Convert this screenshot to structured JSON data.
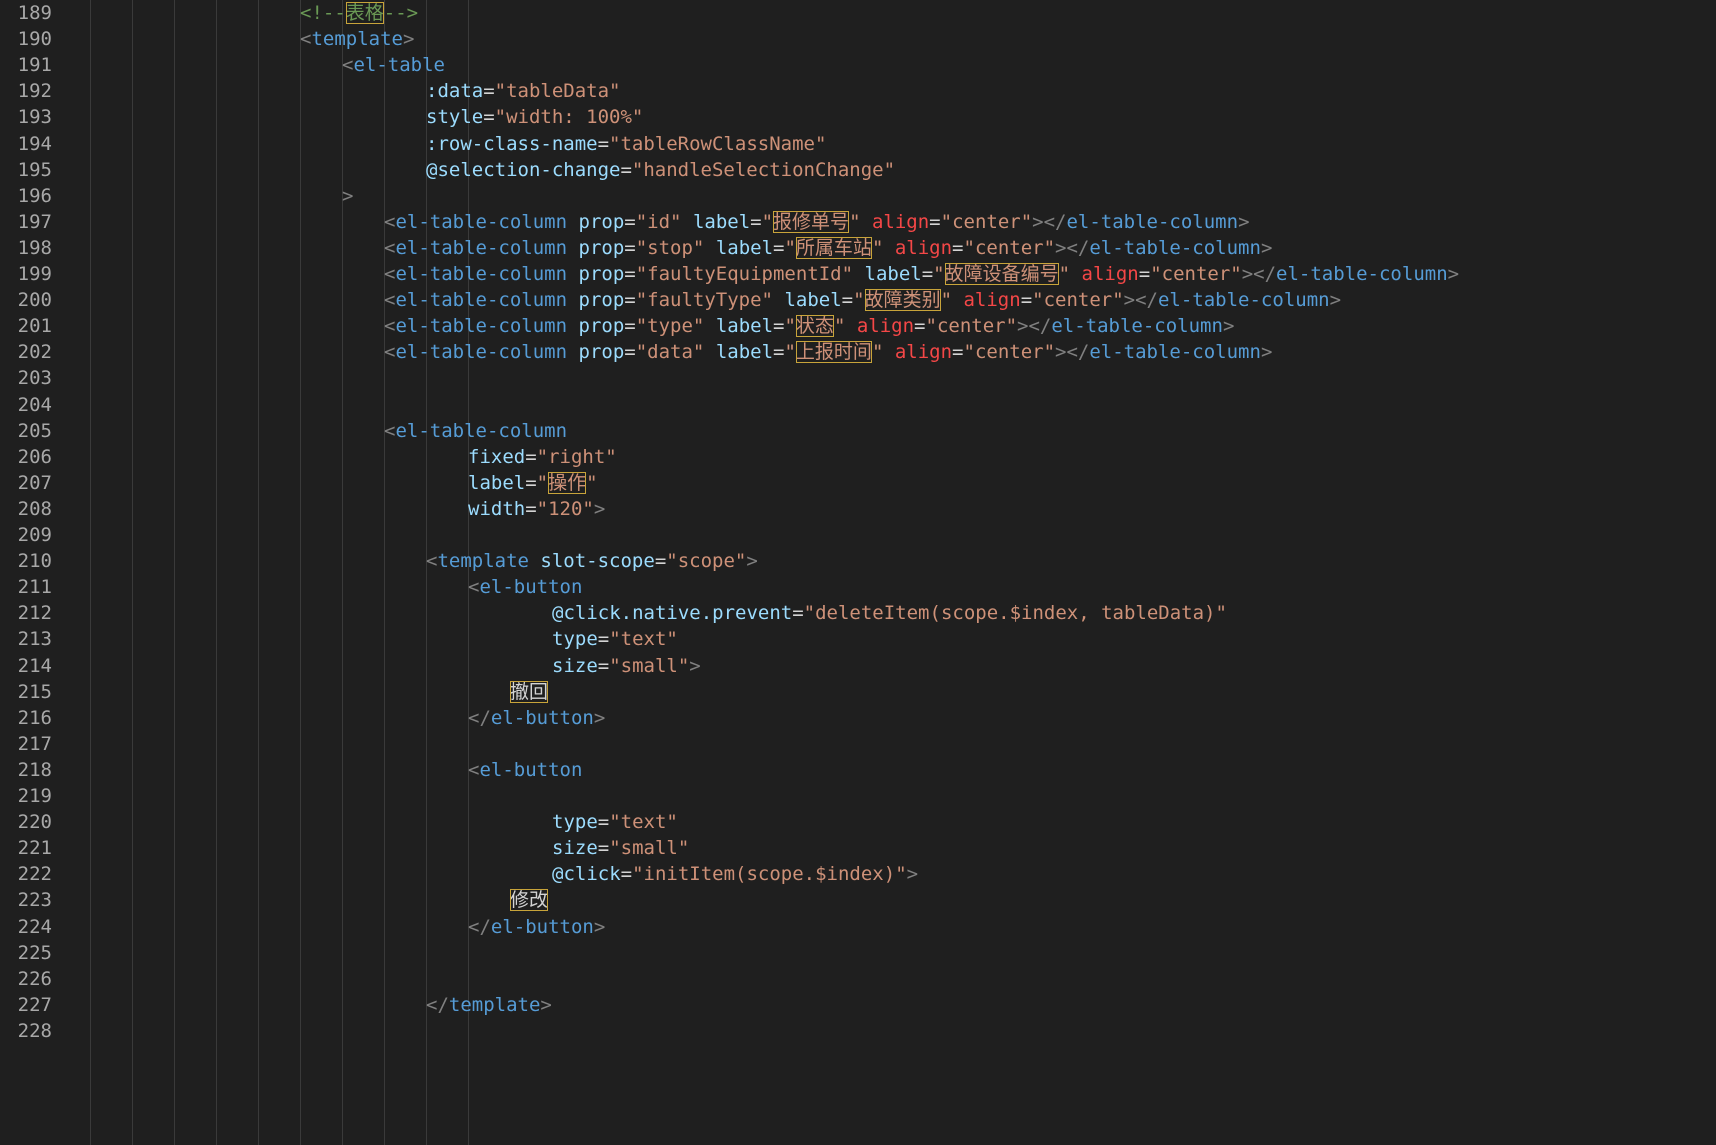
{
  "editor": {
    "language": "vue-template",
    "theme_colors": {
      "background": "#1f1f1f",
      "line_number": "#a8a8a8",
      "tag": "#569cd6",
      "attribute": "#9cdcfe",
      "attribute_alt": "#f44747",
      "string": "#ce9178",
      "comment": "#6a9955",
      "cjk_highlight_border": "#c8a43a"
    },
    "lines": [
      {
        "n": "189",
        "indent": 7,
        "tokens": [
          {
            "t": "<!--",
            "c": "cmt"
          },
          {
            "t": "表格",
            "c": "cmt",
            "box": true
          },
          {
            "t": "-->",
            "c": "cmt"
          }
        ]
      },
      {
        "n": "190",
        "indent": 7,
        "tokens": [
          {
            "t": "<",
            "c": "punc"
          },
          {
            "t": "template",
            "c": "tag"
          },
          {
            "t": ">",
            "c": "punc"
          }
        ]
      },
      {
        "n": "191",
        "indent": 8,
        "tokens": [
          {
            "t": "<",
            "c": "punc"
          },
          {
            "t": "el-table",
            "c": "tag"
          }
        ]
      },
      {
        "n": "192",
        "indent": 10,
        "tokens": [
          {
            "t": ":data",
            "c": "attr"
          },
          {
            "t": "=",
            "c": "txt"
          },
          {
            "t": "\"tableData\"",
            "c": "str"
          }
        ]
      },
      {
        "n": "193",
        "indent": 10,
        "tokens": [
          {
            "t": "style",
            "c": "attr"
          },
          {
            "t": "=",
            "c": "txt"
          },
          {
            "t": "\"width: 100%\"",
            "c": "str"
          }
        ]
      },
      {
        "n": "194",
        "indent": 10,
        "tokens": [
          {
            "t": ":row-class-name",
            "c": "attr"
          },
          {
            "t": "=",
            "c": "txt"
          },
          {
            "t": "\"tableRowClassName\"",
            "c": "str"
          }
        ]
      },
      {
        "n": "195",
        "indent": 10,
        "tokens": [
          {
            "t": "@selection-change",
            "c": "attr"
          },
          {
            "t": "=",
            "c": "txt"
          },
          {
            "t": "\"handleSelectionChange\"",
            "c": "str"
          }
        ]
      },
      {
        "n": "196",
        "indent": 8,
        "tokens": [
          {
            "t": ">",
            "c": "punc"
          }
        ]
      },
      {
        "n": "197",
        "indent": 9,
        "tokens": [
          {
            "t": "<",
            "c": "punc"
          },
          {
            "t": "el-table-column",
            "c": "tag"
          },
          {
            "t": " ",
            "c": "txt"
          },
          {
            "t": "prop",
            "c": "attr"
          },
          {
            "t": "=",
            "c": "txt"
          },
          {
            "t": "\"id\"",
            "c": "str"
          },
          {
            "t": " ",
            "c": "txt"
          },
          {
            "t": "label",
            "c": "attr"
          },
          {
            "t": "=",
            "c": "txt"
          },
          {
            "t": "\"",
            "c": "str"
          },
          {
            "t": "报修单号",
            "c": "str",
            "box": true
          },
          {
            "t": "\"",
            "c": "str"
          },
          {
            "t": " ",
            "c": "txt"
          },
          {
            "t": "align",
            "c": "attr-red"
          },
          {
            "t": "=",
            "c": "txt"
          },
          {
            "t": "\"center\"",
            "c": "str"
          },
          {
            "t": "></",
            "c": "punc"
          },
          {
            "t": "el-table-column",
            "c": "tag"
          },
          {
            "t": ">",
            "c": "punc"
          }
        ]
      },
      {
        "n": "198",
        "indent": 9,
        "tokens": [
          {
            "t": "<",
            "c": "punc"
          },
          {
            "t": "el-table-column",
            "c": "tag"
          },
          {
            "t": " ",
            "c": "txt"
          },
          {
            "t": "prop",
            "c": "attr"
          },
          {
            "t": "=",
            "c": "txt"
          },
          {
            "t": "\"stop\"",
            "c": "str"
          },
          {
            "t": " ",
            "c": "txt"
          },
          {
            "t": "label",
            "c": "attr"
          },
          {
            "t": "=",
            "c": "txt"
          },
          {
            "t": "\"",
            "c": "str"
          },
          {
            "t": "所属车站",
            "c": "str",
            "box": true
          },
          {
            "t": "\"",
            "c": "str"
          },
          {
            "t": " ",
            "c": "txt"
          },
          {
            "t": "align",
            "c": "attr-red"
          },
          {
            "t": "=",
            "c": "txt"
          },
          {
            "t": "\"center\"",
            "c": "str"
          },
          {
            "t": "></",
            "c": "punc"
          },
          {
            "t": "el-table-column",
            "c": "tag"
          },
          {
            "t": ">",
            "c": "punc"
          }
        ]
      },
      {
        "n": "199",
        "indent": 9,
        "tokens": [
          {
            "t": "<",
            "c": "punc"
          },
          {
            "t": "el-table-column",
            "c": "tag"
          },
          {
            "t": " ",
            "c": "txt"
          },
          {
            "t": "prop",
            "c": "attr"
          },
          {
            "t": "=",
            "c": "txt"
          },
          {
            "t": "\"faultyEquipmentId\"",
            "c": "str"
          },
          {
            "t": " ",
            "c": "txt"
          },
          {
            "t": "label",
            "c": "attr"
          },
          {
            "t": "=",
            "c": "txt"
          },
          {
            "t": "\"",
            "c": "str"
          },
          {
            "t": "故障设备编号",
            "c": "str",
            "box": true
          },
          {
            "t": "\"",
            "c": "str"
          },
          {
            "t": " ",
            "c": "txt"
          },
          {
            "t": "align",
            "c": "attr-red"
          },
          {
            "t": "=",
            "c": "txt"
          },
          {
            "t": "\"center\"",
            "c": "str"
          },
          {
            "t": "></",
            "c": "punc"
          },
          {
            "t": "el-table-column",
            "c": "tag"
          },
          {
            "t": ">",
            "c": "punc"
          }
        ]
      },
      {
        "n": "200",
        "indent": 9,
        "tokens": [
          {
            "t": "<",
            "c": "punc"
          },
          {
            "t": "el-table-column",
            "c": "tag"
          },
          {
            "t": " ",
            "c": "txt"
          },
          {
            "t": "prop",
            "c": "attr"
          },
          {
            "t": "=",
            "c": "txt"
          },
          {
            "t": "\"faultyType\"",
            "c": "str"
          },
          {
            "t": " ",
            "c": "txt"
          },
          {
            "t": "label",
            "c": "attr"
          },
          {
            "t": "=",
            "c": "txt"
          },
          {
            "t": "\"",
            "c": "str"
          },
          {
            "t": "故障类别",
            "c": "str",
            "box": true
          },
          {
            "t": "\"",
            "c": "str"
          },
          {
            "t": " ",
            "c": "txt"
          },
          {
            "t": "align",
            "c": "attr-red"
          },
          {
            "t": "=",
            "c": "txt"
          },
          {
            "t": "\"center\"",
            "c": "str"
          },
          {
            "t": "></",
            "c": "punc"
          },
          {
            "t": "el-table-column",
            "c": "tag"
          },
          {
            "t": ">",
            "c": "punc"
          }
        ]
      },
      {
        "n": "201",
        "indent": 9,
        "tokens": [
          {
            "t": "<",
            "c": "punc"
          },
          {
            "t": "el-table-column",
            "c": "tag"
          },
          {
            "t": " ",
            "c": "txt"
          },
          {
            "t": "prop",
            "c": "attr"
          },
          {
            "t": "=",
            "c": "txt"
          },
          {
            "t": "\"type\"",
            "c": "str"
          },
          {
            "t": " ",
            "c": "txt"
          },
          {
            "t": "label",
            "c": "attr"
          },
          {
            "t": "=",
            "c": "txt"
          },
          {
            "t": "\"",
            "c": "str"
          },
          {
            "t": "状态",
            "c": "str",
            "box": true
          },
          {
            "t": "\"",
            "c": "str"
          },
          {
            "t": " ",
            "c": "txt"
          },
          {
            "t": "align",
            "c": "attr-red"
          },
          {
            "t": "=",
            "c": "txt"
          },
          {
            "t": "\"center\"",
            "c": "str"
          },
          {
            "t": "></",
            "c": "punc"
          },
          {
            "t": "el-table-column",
            "c": "tag"
          },
          {
            "t": ">",
            "c": "punc"
          }
        ]
      },
      {
        "n": "202",
        "indent": 9,
        "tokens": [
          {
            "t": "<",
            "c": "punc"
          },
          {
            "t": "el-table-column",
            "c": "tag"
          },
          {
            "t": " ",
            "c": "txt"
          },
          {
            "t": "prop",
            "c": "attr"
          },
          {
            "t": "=",
            "c": "txt"
          },
          {
            "t": "\"data\"",
            "c": "str"
          },
          {
            "t": " ",
            "c": "txt"
          },
          {
            "t": "label",
            "c": "attr"
          },
          {
            "t": "=",
            "c": "txt"
          },
          {
            "t": "\"",
            "c": "str"
          },
          {
            "t": "上报时间",
            "c": "str",
            "box": true
          },
          {
            "t": "\"",
            "c": "str"
          },
          {
            "t": " ",
            "c": "txt"
          },
          {
            "t": "align",
            "c": "attr-red"
          },
          {
            "t": "=",
            "c": "txt"
          },
          {
            "t": "\"center\"",
            "c": "str"
          },
          {
            "t": "></",
            "c": "punc"
          },
          {
            "t": "el-table-column",
            "c": "tag"
          },
          {
            "t": ">",
            "c": "punc"
          }
        ]
      },
      {
        "n": "203",
        "indent": 0,
        "tokens": []
      },
      {
        "n": "204",
        "indent": 0,
        "tokens": []
      },
      {
        "n": "205",
        "indent": 9,
        "tokens": [
          {
            "t": "<",
            "c": "punc"
          },
          {
            "t": "el-table-column",
            "c": "tag"
          }
        ]
      },
      {
        "n": "206",
        "indent": 11,
        "tokens": [
          {
            "t": "fixed",
            "c": "attr"
          },
          {
            "t": "=",
            "c": "txt"
          },
          {
            "t": "\"right\"",
            "c": "str"
          }
        ]
      },
      {
        "n": "207",
        "indent": 11,
        "tokens": [
          {
            "t": "label",
            "c": "attr"
          },
          {
            "t": "=",
            "c": "txt"
          },
          {
            "t": "\"",
            "c": "str"
          },
          {
            "t": "操作",
            "c": "str",
            "box": true
          },
          {
            "t": "\"",
            "c": "str"
          }
        ]
      },
      {
        "n": "208",
        "indent": 11,
        "tokens": [
          {
            "t": "width",
            "c": "attr"
          },
          {
            "t": "=",
            "c": "txt"
          },
          {
            "t": "\"120\"",
            "c": "str"
          },
          {
            "t": ">",
            "c": "punc"
          }
        ]
      },
      {
        "n": "209",
        "indent": 0,
        "tokens": []
      },
      {
        "n": "210",
        "indent": 10,
        "tokens": [
          {
            "t": "<",
            "c": "punc"
          },
          {
            "t": "template",
            "c": "tag"
          },
          {
            "t": " ",
            "c": "txt"
          },
          {
            "t": "slot-scope",
            "c": "attr"
          },
          {
            "t": "=",
            "c": "txt"
          },
          {
            "t": "\"scope\"",
            "c": "str"
          },
          {
            "t": ">",
            "c": "punc"
          }
        ]
      },
      {
        "n": "211",
        "indent": 11,
        "tokens": [
          {
            "t": "<",
            "c": "punc"
          },
          {
            "t": "el-button",
            "c": "tag"
          }
        ]
      },
      {
        "n": "212",
        "indent": 13,
        "tokens": [
          {
            "t": "@click.native.prevent",
            "c": "attr"
          },
          {
            "t": "=",
            "c": "txt"
          },
          {
            "t": "\"deleteItem(scope.$index, tableData)\"",
            "c": "str"
          }
        ]
      },
      {
        "n": "213",
        "indent": 13,
        "tokens": [
          {
            "t": "type",
            "c": "attr"
          },
          {
            "t": "=",
            "c": "txt"
          },
          {
            "t": "\"text\"",
            "c": "str"
          }
        ]
      },
      {
        "n": "214",
        "indent": 13,
        "tokens": [
          {
            "t": "size",
            "c": "attr"
          },
          {
            "t": "=",
            "c": "txt"
          },
          {
            "t": "\"small\"",
            "c": "str"
          },
          {
            "t": ">",
            "c": "punc"
          }
        ]
      },
      {
        "n": "215",
        "indent": 12,
        "tokens": [
          {
            "t": "撤回",
            "c": "txt",
            "box": true
          }
        ]
      },
      {
        "n": "216",
        "indent": 11,
        "tokens": [
          {
            "t": "</",
            "c": "punc"
          },
          {
            "t": "el-button",
            "c": "tag"
          },
          {
            "t": ">",
            "c": "punc"
          }
        ]
      },
      {
        "n": "217",
        "indent": 0,
        "tokens": []
      },
      {
        "n": "218",
        "indent": 11,
        "tokens": [
          {
            "t": "<",
            "c": "punc"
          },
          {
            "t": "el-button",
            "c": "tag"
          }
        ]
      },
      {
        "n": "219",
        "indent": 0,
        "tokens": []
      },
      {
        "n": "220",
        "indent": 13,
        "tokens": [
          {
            "t": "type",
            "c": "attr"
          },
          {
            "t": "=",
            "c": "txt"
          },
          {
            "t": "\"text\"",
            "c": "str"
          }
        ]
      },
      {
        "n": "221",
        "indent": 13,
        "tokens": [
          {
            "t": "size",
            "c": "attr"
          },
          {
            "t": "=",
            "c": "txt"
          },
          {
            "t": "\"small\"",
            "c": "str"
          }
        ]
      },
      {
        "n": "222",
        "indent": 13,
        "tokens": [
          {
            "t": "@click",
            "c": "attr"
          },
          {
            "t": "=",
            "c": "txt"
          },
          {
            "t": "\"initItem(scope.$index)\"",
            "c": "str"
          },
          {
            "t": ">",
            "c": "punc"
          }
        ]
      },
      {
        "n": "223",
        "indent": 12,
        "tokens": [
          {
            "t": "修改",
            "c": "txt",
            "box": true
          }
        ]
      },
      {
        "n": "224",
        "indent": 11,
        "tokens": [
          {
            "t": "</",
            "c": "punc"
          },
          {
            "t": "el-button",
            "c": "tag"
          },
          {
            "t": ">",
            "c": "punc"
          }
        ]
      },
      {
        "n": "225",
        "indent": 0,
        "tokens": []
      },
      {
        "n": "226",
        "indent": 0,
        "tokens": []
      },
      {
        "n": "227",
        "indent": 10,
        "tokens": [
          {
            "t": "</",
            "c": "punc"
          },
          {
            "t": "template",
            "c": "tag"
          },
          {
            "t": ">",
            "c": "punc"
          }
        ]
      },
      {
        "n": "228",
        "indent": 0,
        "tokens": []
      }
    ]
  }
}
